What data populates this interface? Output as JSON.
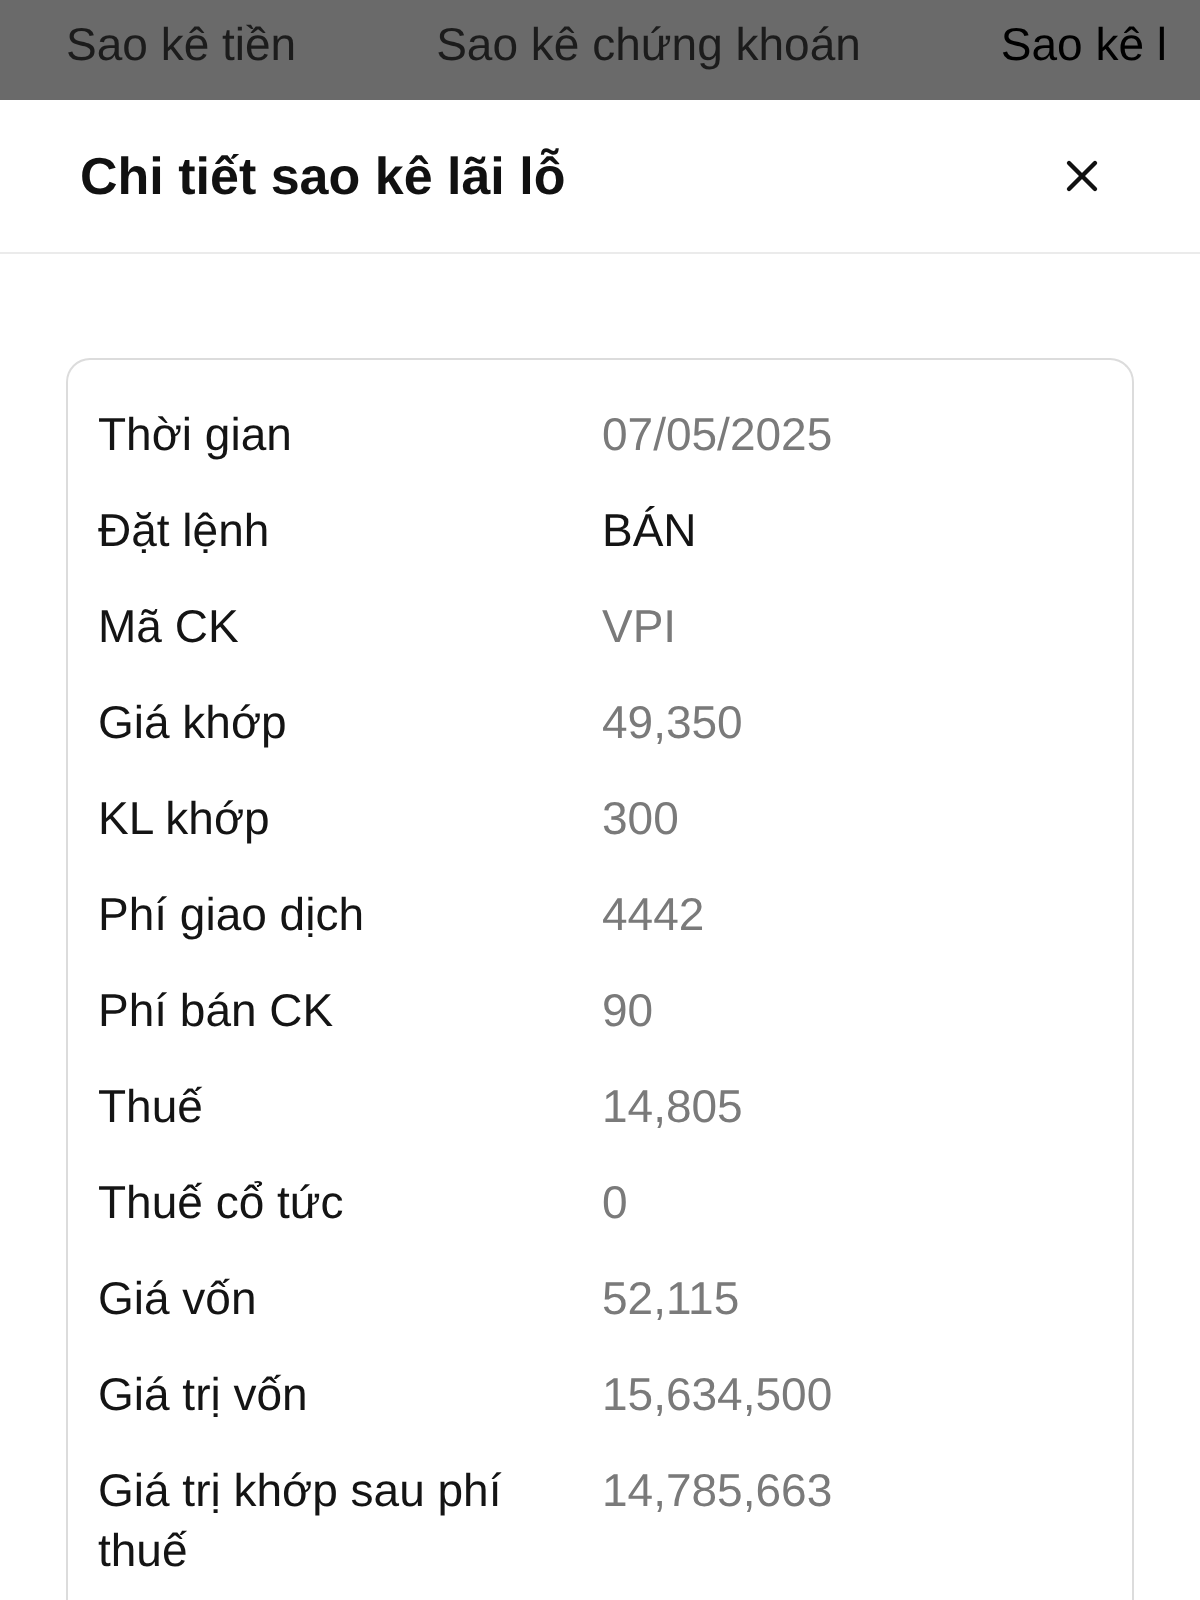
{
  "tabs": [
    {
      "label": "Sao kê tiền",
      "selected": false
    },
    {
      "label": "Sao kê chứng khoán",
      "selected": false
    },
    {
      "label": "Sao kê l",
      "selected": true
    }
  ],
  "dialog": {
    "title": "Chi tiết sao kê lãi lỗ"
  },
  "details": [
    {
      "label": "Thời gian",
      "value": "07/05/2025",
      "emphasis": false
    },
    {
      "label": "Đặt lệnh",
      "value": "BÁN",
      "emphasis": true
    },
    {
      "label": "Mã CK",
      "value": "VPI",
      "emphasis": false
    },
    {
      "label": "Giá khớp",
      "value": "49,350",
      "emphasis": false
    },
    {
      "label": "KL khớp",
      "value": "300",
      "emphasis": false
    },
    {
      "label": "Phí giao dịch",
      "value": "4442",
      "emphasis": false
    },
    {
      "label": "Phí bán CK",
      "value": "90",
      "emphasis": false
    },
    {
      "label": "Thuế",
      "value": "14,805",
      "emphasis": false
    },
    {
      "label": "Thuế cổ tức",
      "value": "0",
      "emphasis": false
    },
    {
      "label": "Giá vốn",
      "value": "52,115",
      "emphasis": false
    },
    {
      "label": "Giá trị vốn",
      "value": "15,634,500",
      "emphasis": false
    },
    {
      "label": "Giá trị khớp sau phí thuế",
      "value": "14,785,663",
      "emphasis": false
    }
  ]
}
